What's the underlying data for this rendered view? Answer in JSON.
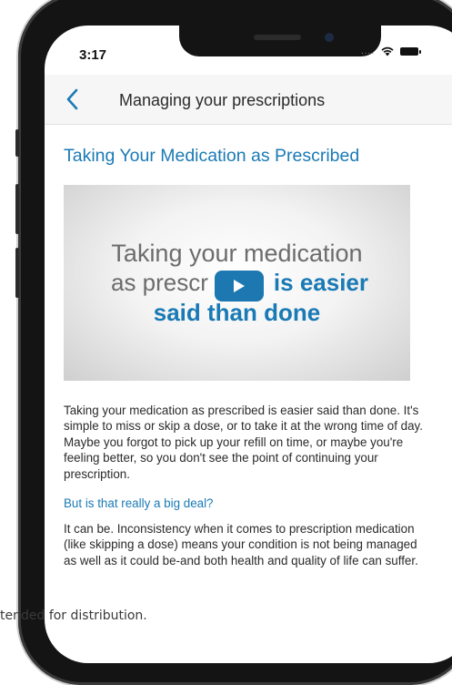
{
  "status_bar": {
    "time": "3:17",
    "signal": "...."
  },
  "nav": {
    "title": "Managing your prescriptions",
    "back_icon": "chevron-left-icon"
  },
  "article": {
    "title": "Taking Your Medication as Prescribed",
    "video": {
      "line1": "Taking your medication",
      "line2_start": "as prescr",
      "line2_accent": "is easier",
      "line3": "said than done",
      "play_icon": "play-icon"
    },
    "paragraph1": "Taking your medication as prescribed is easier said than done. It's simple to miss or skip a dose, or to take it at the wrong time of day. Maybe you forgot to pick up your refill on time, or maybe you're feeling better, so you don't see the point of continuing your prescription.",
    "subheading": "But is that really a big deal?",
    "paragraph2": "It can be. Inconsistency when it comes to prescription medication (like skipping a dose) means your condition is not being managed as well as it could be-and both health and quality of life can suffer."
  },
  "footer_note": "tended for distribution.",
  "colors": {
    "accent": "#1a7ab5",
    "play_button": "#1d77b0"
  }
}
